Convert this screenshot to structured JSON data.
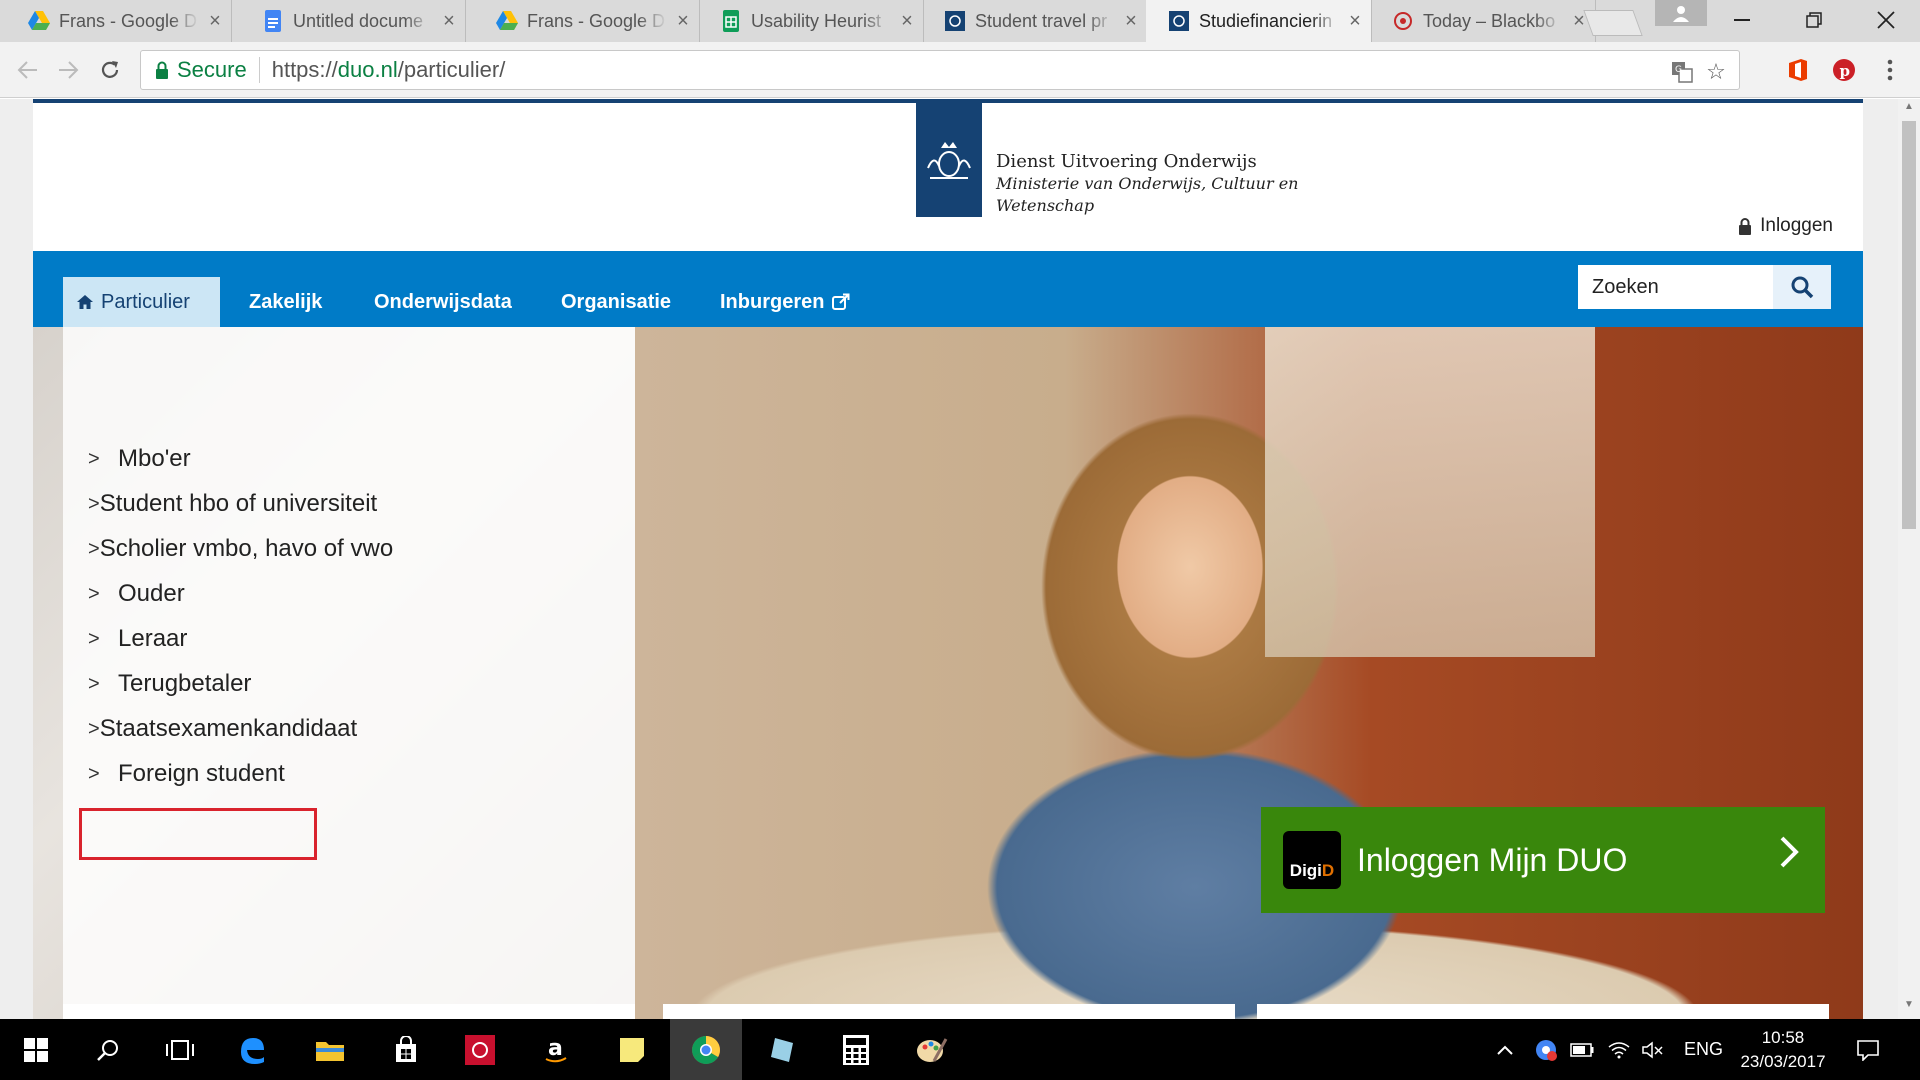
{
  "browser": {
    "tabs": [
      {
        "label": "Frans - Google D",
        "icon": "google-drive-icon"
      },
      {
        "label": "Untitled docume",
        "icon": "google-docs-icon"
      },
      {
        "label": "Frans - Google D",
        "icon": "google-drive-icon"
      },
      {
        "label": "Usability Heurist",
        "icon": "google-sheets-icon"
      },
      {
        "label": "Student travel pr",
        "icon": "duo-crest-icon"
      },
      {
        "label": "Studiefinancierin",
        "icon": "duo-crest-icon"
      },
      {
        "label": "Today – Blackbo",
        "icon": "blackboard-icon"
      }
    ],
    "active_tab_index": 5,
    "secure_label": "Secure",
    "url_prefix": "https://",
    "url_host": "duo.nl",
    "url_path": "/particulier/"
  },
  "header": {
    "org_line1": "Dienst Uitvoering Onderwijs",
    "org_line2": "Ministerie van Onderwijs, Cultuur en",
    "org_line3": "Wetenschap",
    "login_label": "Inloggen"
  },
  "nav": {
    "items": [
      "Particulier",
      "Zakelijk",
      "Onderwijsdata",
      "Organisatie",
      "Inburgeren"
    ],
    "search_placeholder": "Zoeken"
  },
  "menu": {
    "items": [
      "Mbo'er",
      "Student hbo of universiteit",
      "Scholier vmbo, havo of vwo",
      "Ouder",
      "Leraar",
      "Terugbetaler",
      "Staatsexamenkandidaat",
      "Foreign student"
    ],
    "highlighted_index": 7
  },
  "cta": {
    "digid_prefix": "Digi",
    "digid_suffix": "D",
    "label": "Inloggen Mijn DUO"
  },
  "taskbar": {
    "language": "ENG",
    "time": "10:58",
    "date": "23/03/2017"
  },
  "colors": {
    "rijks_blue": "#154273",
    "nav_blue": "#007bc7",
    "cta_green": "#39870c",
    "highlight_red": "#d9232d"
  }
}
